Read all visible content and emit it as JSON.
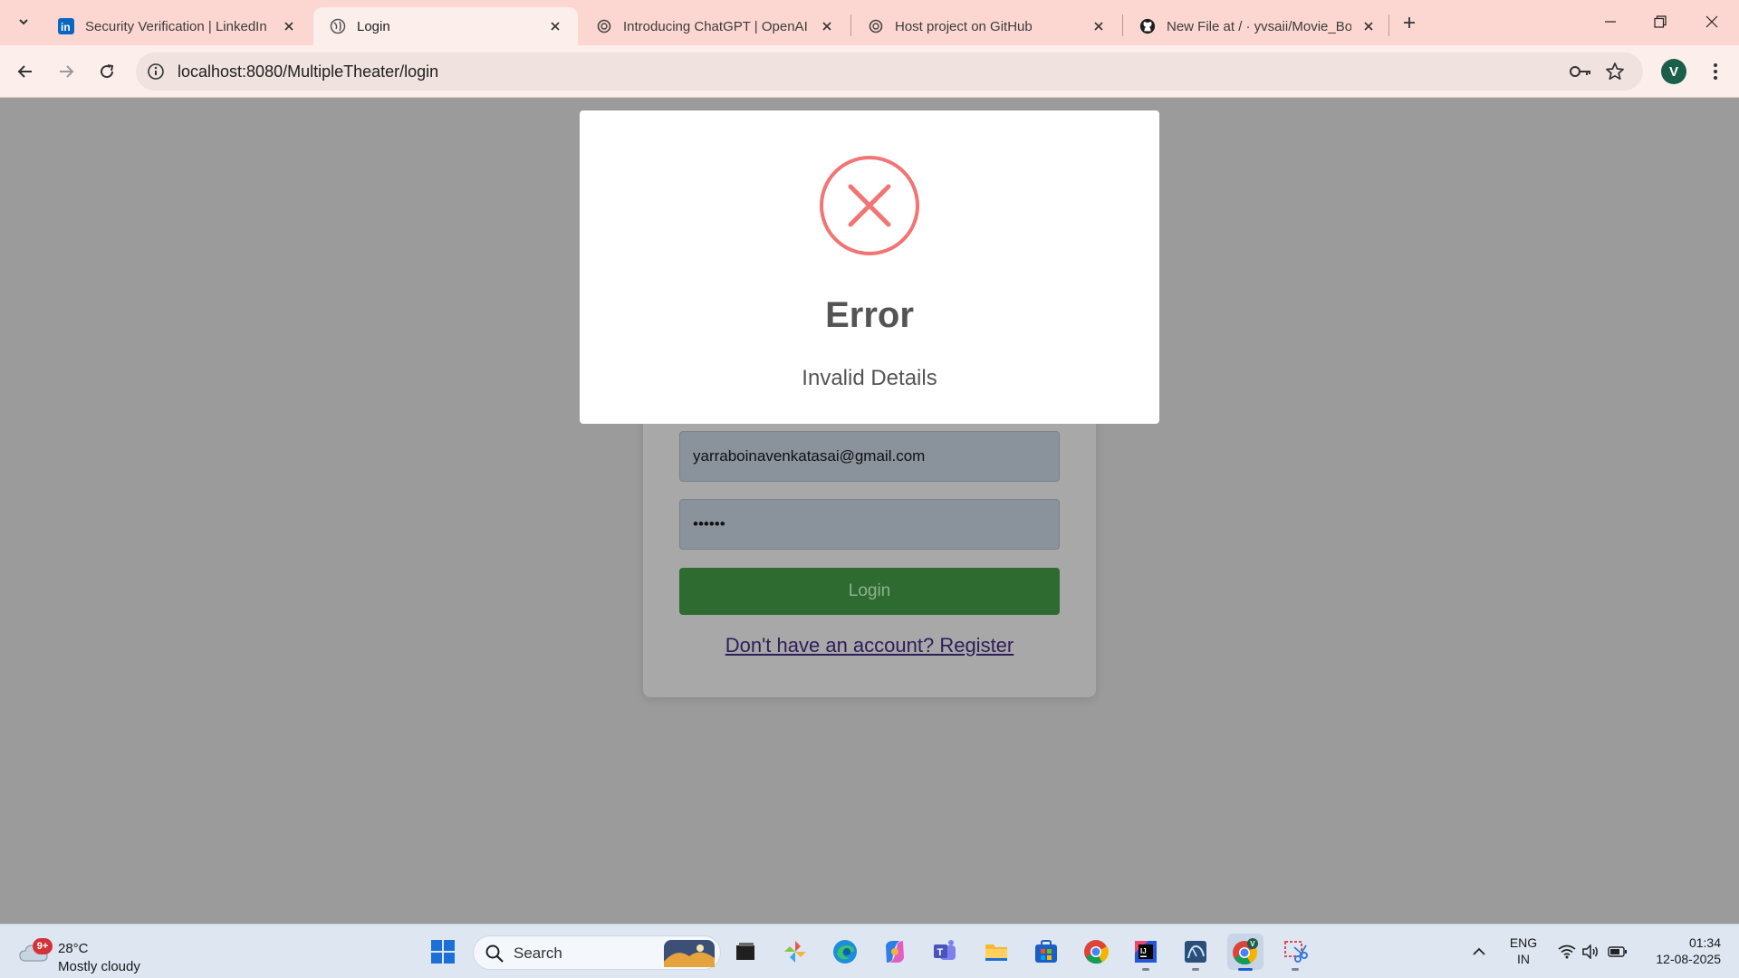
{
  "tabs": [
    {
      "title": "Security Verification | LinkedIn",
      "icon": "linkedin-icon",
      "active": false
    },
    {
      "title": "Login",
      "icon": "globe-icon",
      "active": true
    },
    {
      "title": "Introducing ChatGPT | OpenAI",
      "icon": "openai-icon",
      "active": false
    },
    {
      "title": "Host project on GitHub",
      "icon": "openai-icon",
      "active": false
    },
    {
      "title": "New File at / · yvsaii/Movie_Boo",
      "icon": "github-icon",
      "active": false
    }
  ],
  "address_bar": {
    "url": "localhost:8080/MultipleTheater/login"
  },
  "profile": {
    "initial": "V"
  },
  "login_form": {
    "email_value": "yarraboinavenkatasai@gmail.com",
    "password_value": "••••••",
    "login_label": "Login",
    "register_link": "Don't have an account? Register"
  },
  "alert": {
    "title": "Error",
    "message": "Invalid Details",
    "icon": "error-x-icon",
    "accent_color": "#f27474"
  },
  "taskbar": {
    "weather_badge": "9+",
    "weather_temp": "28°C",
    "weather_desc": "Mostly cloudy",
    "search_label": "Search",
    "apps": [
      "start-icon",
      "task-view-icon",
      "pinwheel-app-icon",
      "edge-icon",
      "copilot-icon",
      "teams-icon",
      "file-explorer-icon",
      "store-icon",
      "chrome-icon",
      "intellij-icon",
      "mysql-workbench-icon",
      "chrome-profile-icon",
      "snipping-tool-icon"
    ],
    "lang_primary": "ENG",
    "lang_secondary": "IN",
    "time": "01:34",
    "date": "12-08-2025"
  }
}
